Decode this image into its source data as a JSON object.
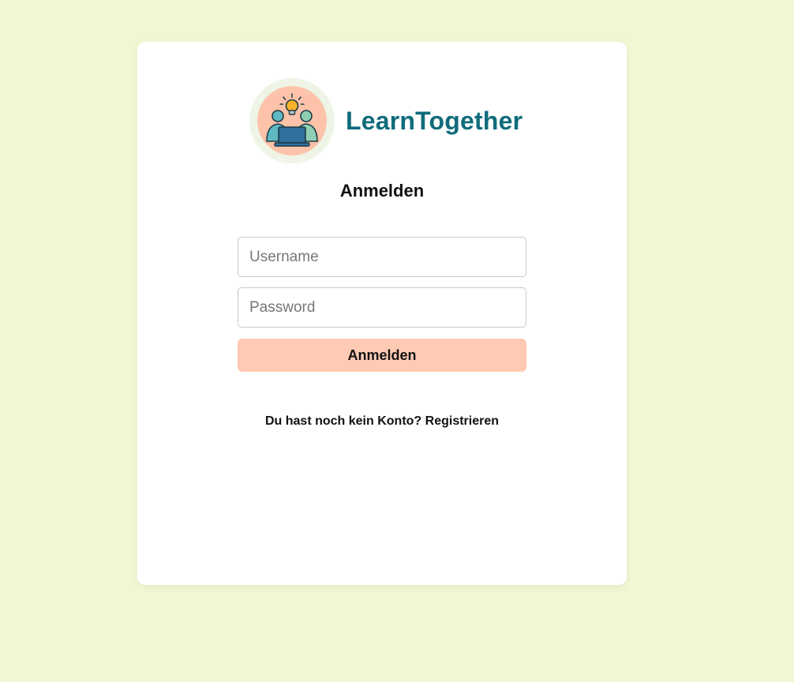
{
  "brand": {
    "name": "LearnTogether",
    "logo_icon": "team-collaboration-laptop-lightbulb-icon"
  },
  "form": {
    "title": "Anmelden",
    "username_placeholder": "Username",
    "password_placeholder": "Password",
    "submit_label": "Anmelden"
  },
  "footer": {
    "prompt": "Du hast noch kein Konto?",
    "register_link": "Registrieren"
  },
  "colors": {
    "page_background": "#f2f6d2",
    "brand_text": "#0f6b7c",
    "button_background": "#ffcab4",
    "logo_ring": "#eef5e6",
    "logo_fill": "#fcc3aa"
  }
}
